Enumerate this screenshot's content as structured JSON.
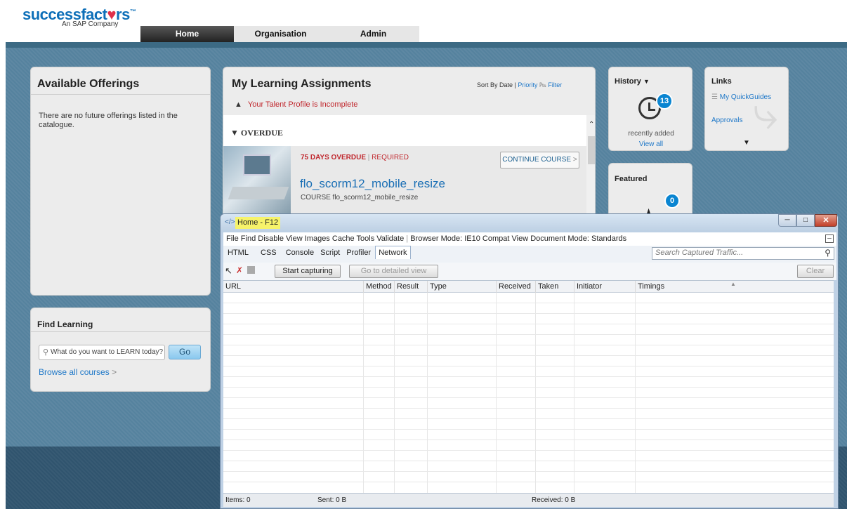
{
  "brand": {
    "name_part1": "successfact",
    "name_heart": "♥",
    "name_part2": "rs",
    "tm": "™",
    "tagline": "An SAP Company"
  },
  "nav": {
    "tabs": [
      {
        "label": "Home"
      },
      {
        "label": "Organisation"
      },
      {
        "label": "Admin"
      }
    ]
  },
  "available_offerings": {
    "title": "Available Offerings",
    "message": "There are no future offerings listed in the catalogue."
  },
  "find_learning": {
    "title": "Find Learning",
    "search_placeholder": "What do you want to LEARN today?",
    "go_label": "Go",
    "browse_label": "Browse all courses"
  },
  "assignments": {
    "title": "My Learning Assignments",
    "sort_prefix": "Sort By Date |",
    "sort_priority": "Priority",
    "filter_label": "Filter",
    "warning": "Your Talent Profile is Incomplete",
    "section_label": "OVERDUE",
    "item": {
      "overdue": "75 DAYS OVERDUE",
      "separator": "|",
      "required": "REQUIRED",
      "action": "CONTINUE COURSE",
      "title": "flo_scorm12_mobile_resize",
      "subtitle": "COURSE flo_scorm12_mobile_resize"
    }
  },
  "history": {
    "title": "History",
    "count": "13",
    "caption": "recently added",
    "link": "View all"
  },
  "featured": {
    "title": "Featured",
    "count": "0"
  },
  "links": {
    "title": "Links",
    "items": [
      {
        "label": "My QuickGuides"
      },
      {
        "label": "Approvals"
      }
    ]
  },
  "devtools": {
    "window_title": "Home - F12",
    "menu": [
      "File",
      "Find",
      "Disable",
      "View",
      "Images",
      "Cache",
      "Tools",
      "Validate"
    ],
    "browser_mode": "Browser Mode: IE10 Compat View",
    "document_mode": "Document Mode: Standards",
    "tabs": [
      "HTML",
      "CSS",
      "Console",
      "Script",
      "Profiler",
      "Network"
    ],
    "active_tab": "Network",
    "search_placeholder": "Search Captured Traffic...",
    "start_capturing": "Start capturing",
    "go_detailed": "Go to detailed view",
    "clear": "Clear",
    "columns": [
      "URL",
      "Method",
      "Result",
      "Type",
      "Received",
      "Taken",
      "Initiator",
      "Timings"
    ],
    "status": {
      "items": "Items: 0",
      "sent": "Sent: 0 B",
      "received": "Received: 0 B"
    }
  },
  "colors": {
    "brand_blue": "#0e6fb8",
    "brand_red": "#e0304a",
    "link_blue": "#1f78c8",
    "overdue_red": "#c0272d",
    "badge_blue": "#0a85d1",
    "page_blue": "#55829e"
  }
}
